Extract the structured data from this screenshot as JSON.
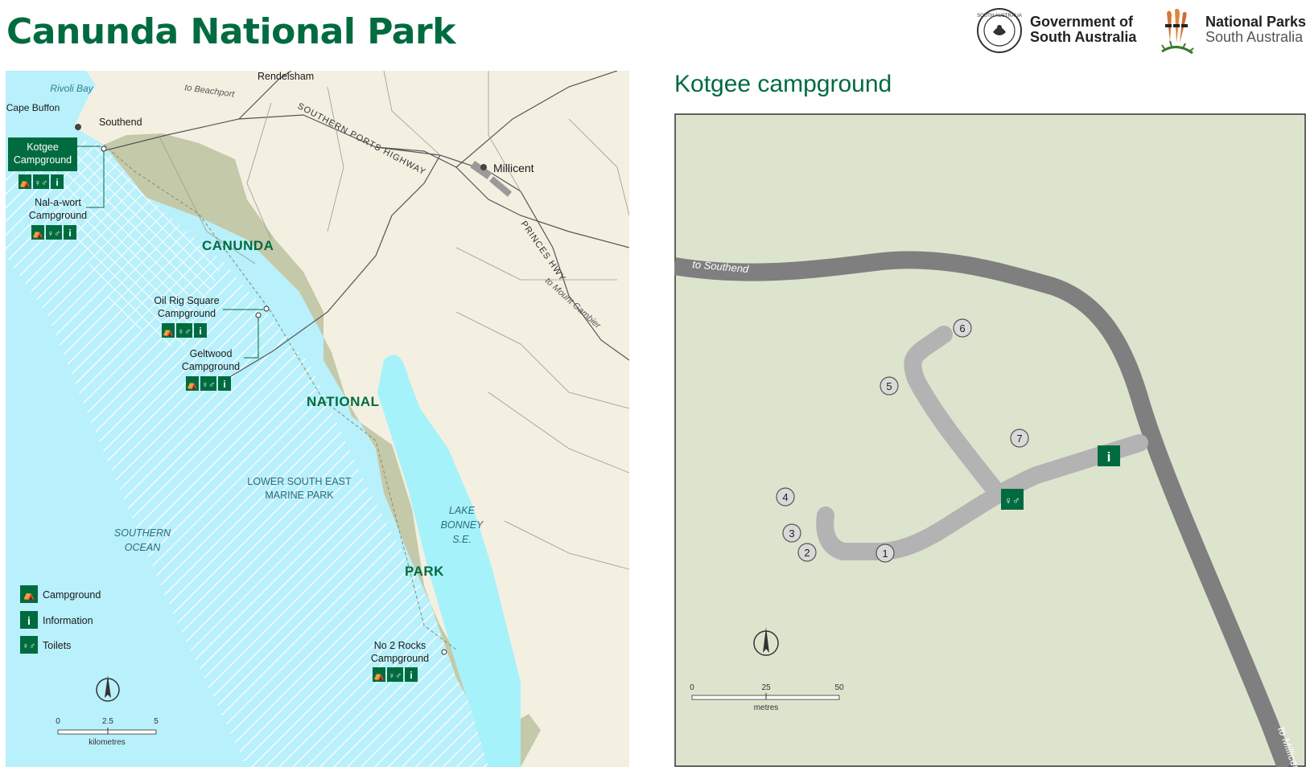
{
  "header": {
    "title": "Canunda National Park",
    "gov_logo_line1": "Government of",
    "gov_logo_line2": "South Australia",
    "seal_text": "SOUTH AUSTRALIA",
    "np_logo_line1": "National Parks",
    "np_logo_line2": "South Australia"
  },
  "overview_map": {
    "places": {
      "rivoli_bay": "Rivoli Bay",
      "cape_buffon": "Cape Buffon",
      "southend": "Southend",
      "rendelsham": "Rendelsham",
      "to_beachport": "to Beachport",
      "southern_ports_highway": "SOUTHERN PORTS HIGHWAY",
      "millicent": "Millicent",
      "princes_hwy": "PRINCES HWY",
      "to_mount_gambier": "to Mount Gambier",
      "canunda": "CANUNDA",
      "national": "NATIONAL",
      "park": "PARK",
      "marine_park": "LOWER SOUTH EAST MARINE PARK",
      "southern_ocean": "SOUTHERN OCEAN",
      "lake_bonney": "LAKE BONNEY S.E."
    },
    "campgrounds": {
      "kotgee": "Kotgee Campground",
      "nal_a_wort": "Nal-a-wort Campground",
      "oil_rig_square": "Oil Rig Square Campground",
      "geltwood": "Geltwood Campground",
      "no2_rocks": "No 2 Rocks Campground"
    },
    "legend": [
      {
        "icon": "campground-icon",
        "label": "Campground"
      },
      {
        "icon": "information-icon",
        "label": "Information"
      },
      {
        "icon": "toilets-icon",
        "label": "Toilets"
      }
    ],
    "scale": {
      "ticks": [
        "0",
        "2.5",
        "5"
      ],
      "unit": "kilometres"
    }
  },
  "kotgee_map": {
    "title": "Kotgee campground",
    "to_southend": "to Southend",
    "to_millicent": "to Millicent",
    "sites": [
      "1",
      "2",
      "3",
      "4",
      "5",
      "6",
      "7"
    ],
    "scale": {
      "ticks": [
        "0",
        "25",
        "50"
      ],
      "unit": "metres"
    }
  },
  "colors": {
    "park_green": "#006b3f",
    "park_land": "#c4c9a9",
    "land": "#f3f0e2",
    "ocean": "#b8f0fb",
    "lake": "#a6f2fa",
    "site_bg": "#dde4ce",
    "road": "#7f7f7f",
    "track": "#b3b3b3"
  }
}
